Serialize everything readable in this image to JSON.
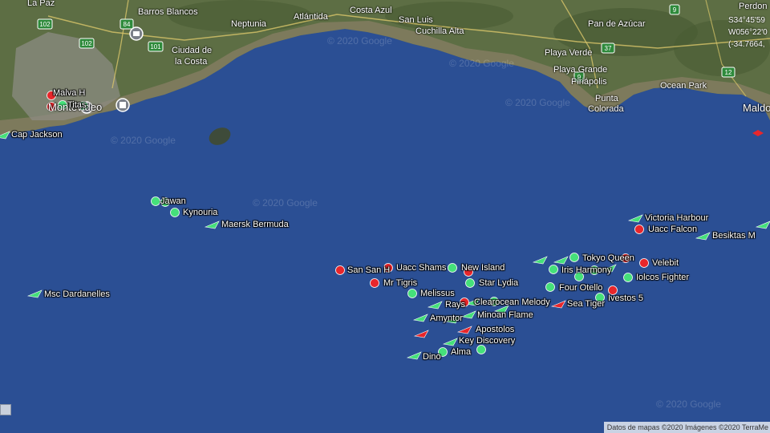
{
  "map": {
    "ocean_color": "#2b4f94",
    "land_color": "#5d6e44",
    "watermark": "© 2020 Google",
    "attribution": "Datos de mapas ©2020 Imágenes ©2020 TerraMe",
    "coords": [
      "S34°45'59",
      "W056°22'0",
      "(-34.7664,"
    ],
    "places": [
      "La Paz",
      "Barros Blancos",
      "Neptunia",
      "Atlántida",
      "Costa Azul",
      "San Luis",
      "Cuchilla Alta",
      "Perdon",
      "Pan de Azúcar",
      "Ciudad de",
      "la Costa",
      "Playa Verde",
      "Playa Grande",
      "Piriápolis",
      "Punta",
      "Colorada",
      "Ocean Park",
      "Maldo",
      "Montevideo"
    ],
    "road_numbers": [
      "102",
      "102",
      "84",
      "101",
      "37",
      "9",
      "12",
      "9"
    ],
    "status_colors": {
      "underway": "#45e07a",
      "moored": "#e8262b"
    }
  },
  "vessels": [
    {
      "name": "Malva H",
      "status": "moored",
      "icon": "circle"
    },
    {
      "name": "Titas",
      "status": "underway",
      "icon": "circle"
    },
    {
      "name": "Cap Jackson",
      "status": "underway",
      "icon": "arrow"
    },
    {
      "name": "Jawan",
      "status": "underway",
      "icon": "circle"
    },
    {
      "name": "Kynouria",
      "status": "underway",
      "icon": "circle"
    },
    {
      "name": "Maersk Bermuda",
      "status": "underway",
      "icon": "arrow"
    },
    {
      "name": "Msc Dardanelles",
      "status": "underway",
      "icon": "arrow"
    },
    {
      "name": "San San H",
      "status": "moored",
      "icon": "circle"
    },
    {
      "name": "Uacc Shams",
      "status": "moored",
      "icon": "circle"
    },
    {
      "name": "New Island",
      "status": "underway",
      "icon": "circle"
    },
    {
      "name": "Mr Tigris",
      "status": "moored",
      "icon": "circle"
    },
    {
      "name": "Star Lydia",
      "status": "underway",
      "icon": "circle"
    },
    {
      "name": "Melissus",
      "status": "underway",
      "icon": "circle"
    },
    {
      "name": "Rays",
      "status": "underway",
      "icon": "arrow"
    },
    {
      "name": "Clearocean Melody",
      "status": "underway",
      "icon": "arrow"
    },
    {
      "name": "Amyntor",
      "status": "underway",
      "icon": "arrow"
    },
    {
      "name": "Minoan Flame",
      "status": "underway",
      "icon": "arrow"
    },
    {
      "name": "Apostolos",
      "status": "moored",
      "icon": "arrow"
    },
    {
      "name": "Key Discovery",
      "status": "underway",
      "icon": "arrow"
    },
    {
      "name": "Alma",
      "status": "underway",
      "icon": "circle"
    },
    {
      "name": "Dino",
      "status": "underway",
      "icon": "arrow"
    },
    {
      "name": "Tokyo Queen",
      "status": "underway",
      "icon": "circle"
    },
    {
      "name": "Iris Harmony",
      "status": "underway",
      "icon": "circle"
    },
    {
      "name": "Four Otello",
      "status": "underway",
      "icon": "circle"
    },
    {
      "name": "Sea Tiger",
      "status": "moored",
      "icon": "arrow"
    },
    {
      "name": "Ivestos 5",
      "status": "moored",
      "icon": "circle"
    },
    {
      "name": "Velebit",
      "status": "moored",
      "icon": "circle"
    },
    {
      "name": "Iolcos Fighter",
      "status": "underway",
      "icon": "circle"
    },
    {
      "name": "Victoria Harbour",
      "status": "underway",
      "icon": "arrow"
    },
    {
      "name": "Uacc Falcon",
      "status": "moored",
      "icon": "circle"
    },
    {
      "name": "Besiktas M",
      "status": "underway",
      "icon": "arrow"
    }
  ]
}
